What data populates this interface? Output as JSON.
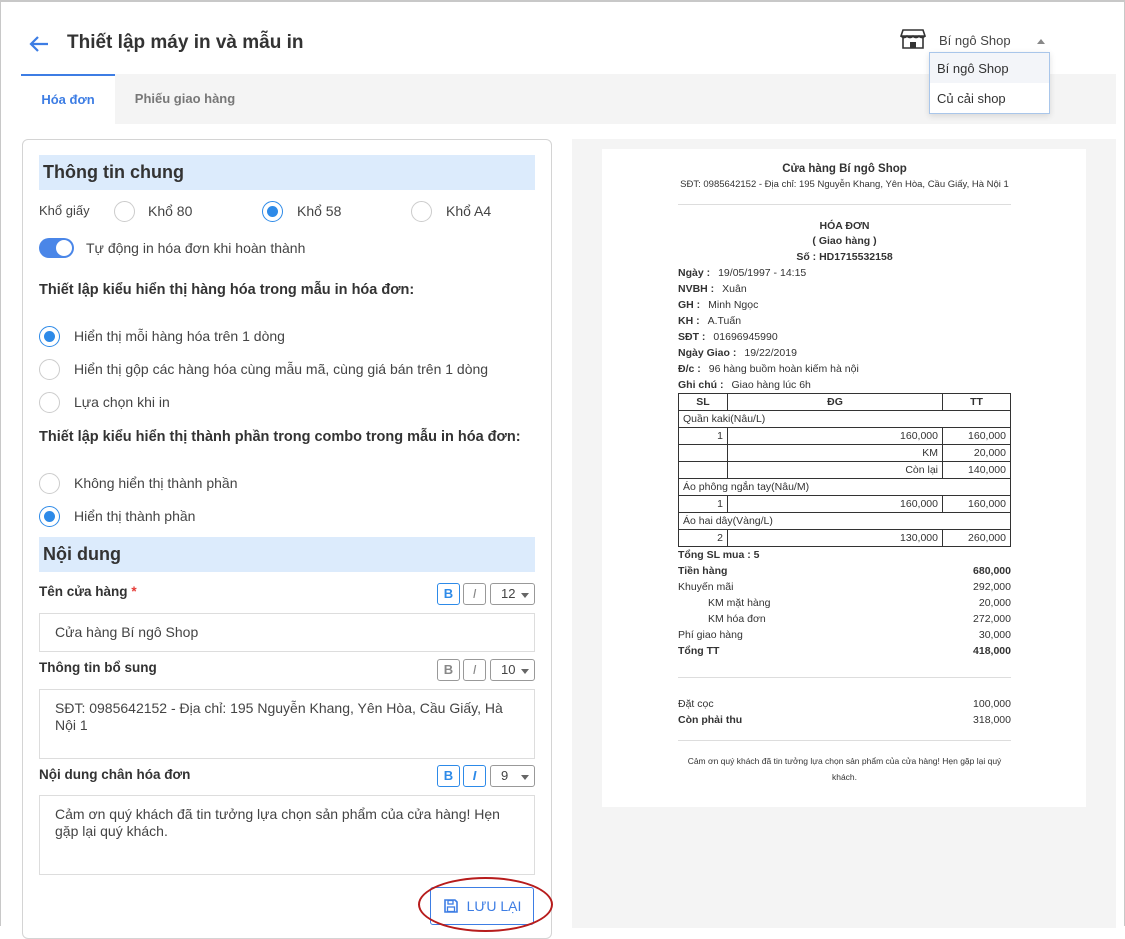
{
  "header": {
    "title": "Thiết lập máy in và mẫu in",
    "shop_selected": "Bí ngô Shop",
    "shop_options": [
      "Bí ngô Shop",
      "Củ cải shop"
    ]
  },
  "tabs": [
    "Hóa đơn",
    "Phiếu giao hàng"
  ],
  "general": {
    "title": "Thông tin chung",
    "paper_label": "Khổ giấy",
    "paper_options": [
      "Khổ 80",
      "Khổ 58",
      "Khổ A4"
    ],
    "paper_selected": "Khổ 58",
    "auto_print_label": "Tự động in hóa đơn khi hoàn thành",
    "auto_print": true,
    "item_display_title": "Thiết lập kiểu hiển thị hàng hóa trong mẫu in hóa đơn:",
    "item_display_options": [
      "Hiển thị mỗi hàng hóa trên 1 dòng",
      "Hiển thị gộp các hàng hóa cùng mẫu mã, cùng giá bán trên 1 dòng",
      "Lựa chọn khi in"
    ],
    "item_display_selected": 0,
    "combo_title": "Thiết lập kiểu hiển thị thành phần trong combo trong mẫu in hóa đơn:",
    "combo_options": [
      "Không hiển thị thành phần",
      "Hiển thị thành phần"
    ],
    "combo_selected": 1
  },
  "content": {
    "title": "Nội dung",
    "fields": [
      {
        "label": "Tên cửa hàng",
        "required": "*",
        "bold": true,
        "italic": false,
        "size": "12",
        "value": "Cửa hàng Bí ngô Shop"
      },
      {
        "label": "Thông tin bổ sung",
        "bold": false,
        "italic": false,
        "size": "10",
        "value": "SĐT: 0985642152 - Địa chỉ: 195 Nguyễn Khang, Yên Hòa, Cầu Giấy, Hà Nội 1"
      },
      {
        "label": "Nội dung chân hóa đơn",
        "bold": true,
        "italic": true,
        "size": "9",
        "value": "Cảm ơn quý khách đã tin tưởng lựa chọn sản phẩm của cửa hàng! Hẹn gặp lại quý khách."
      }
    ],
    "bold_label": "B",
    "italic_label": "I",
    "save_label": "LƯU LẠI"
  },
  "receipt": {
    "shop": "Cửa hàng Bí ngô Shop",
    "info": "SĐT: 0985642152 - Địa chỉ: 195 Nguyễn Khang, Yên Hòa, Cầu Giấy, Hà Nội 1",
    "title": "HÓA ĐƠN",
    "subtitle": "( Giao hàng )",
    "number": "Số : HD1715532158",
    "meta": [
      {
        "k": "Ngày :",
        "v": "19/05/1997 - 14:15"
      },
      {
        "k": "NVBH :",
        "v": "Xuân"
      },
      {
        "k": "GH :",
        "v": "Minh Ngọc"
      },
      {
        "k": "KH :",
        "v": "A.Tuấn"
      },
      {
        "k": "SĐT :",
        "v": "01696945990"
      },
      {
        "k": "Ngày Giao :",
        "v": "19/22/2019"
      },
      {
        "k": "Đ/c :",
        "v": "96 hàng buồm hoàn kiếm hà nội"
      },
      {
        "k": "Ghi chú :",
        "v": "Giao hàng lúc 6h"
      }
    ],
    "cols": [
      "SL",
      "ĐG",
      "TT"
    ],
    "items": [
      {
        "name": "Quần kaki(Nâu/L)",
        "rows": [
          [
            "1",
            "160,000",
            "160,000"
          ],
          [
            "",
            "KM",
            "20,000"
          ],
          [
            "",
            "Còn lại",
            "140,000"
          ]
        ]
      },
      {
        "name": "Áo phông ngắn tay(Nâu/M)",
        "rows": [
          [
            "1",
            "160,000",
            "160,000"
          ]
        ]
      },
      {
        "name": "Áo hai dây(Vàng/L)",
        "rows": [
          [
            "2",
            "130,000",
            "260,000"
          ]
        ]
      }
    ],
    "total_qty": "Tổng SL mua : 5",
    "summary": [
      {
        "k": "Tiền hàng",
        "v": "680,000",
        "bold": true
      },
      {
        "k": "Khuyến mãi",
        "v": "292,000"
      },
      {
        "k": "KM mặt hàng",
        "v": "20,000",
        "indent": true
      },
      {
        "k": "KM hóa đơn",
        "v": "272,000",
        "indent": true
      },
      {
        "k": "Phí giao hàng",
        "v": "30,000"
      },
      {
        "k": "Tổng TT",
        "v": "418,000",
        "bold": true
      }
    ],
    "deposit": {
      "k": "Đặt cọc",
      "v": "100,000"
    },
    "remaining": {
      "k": "Còn phải thu",
      "v": "318,000"
    },
    "footer": "Cảm ơn quý khách đã tin tưởng lựa chọn sản phẩm của cửa hàng! Hẹn gặp lại quý khách."
  },
  "colors": {
    "accent": "#3d7de4",
    "section_bg": "#dcebfc",
    "highlight": "#b71c1c"
  }
}
